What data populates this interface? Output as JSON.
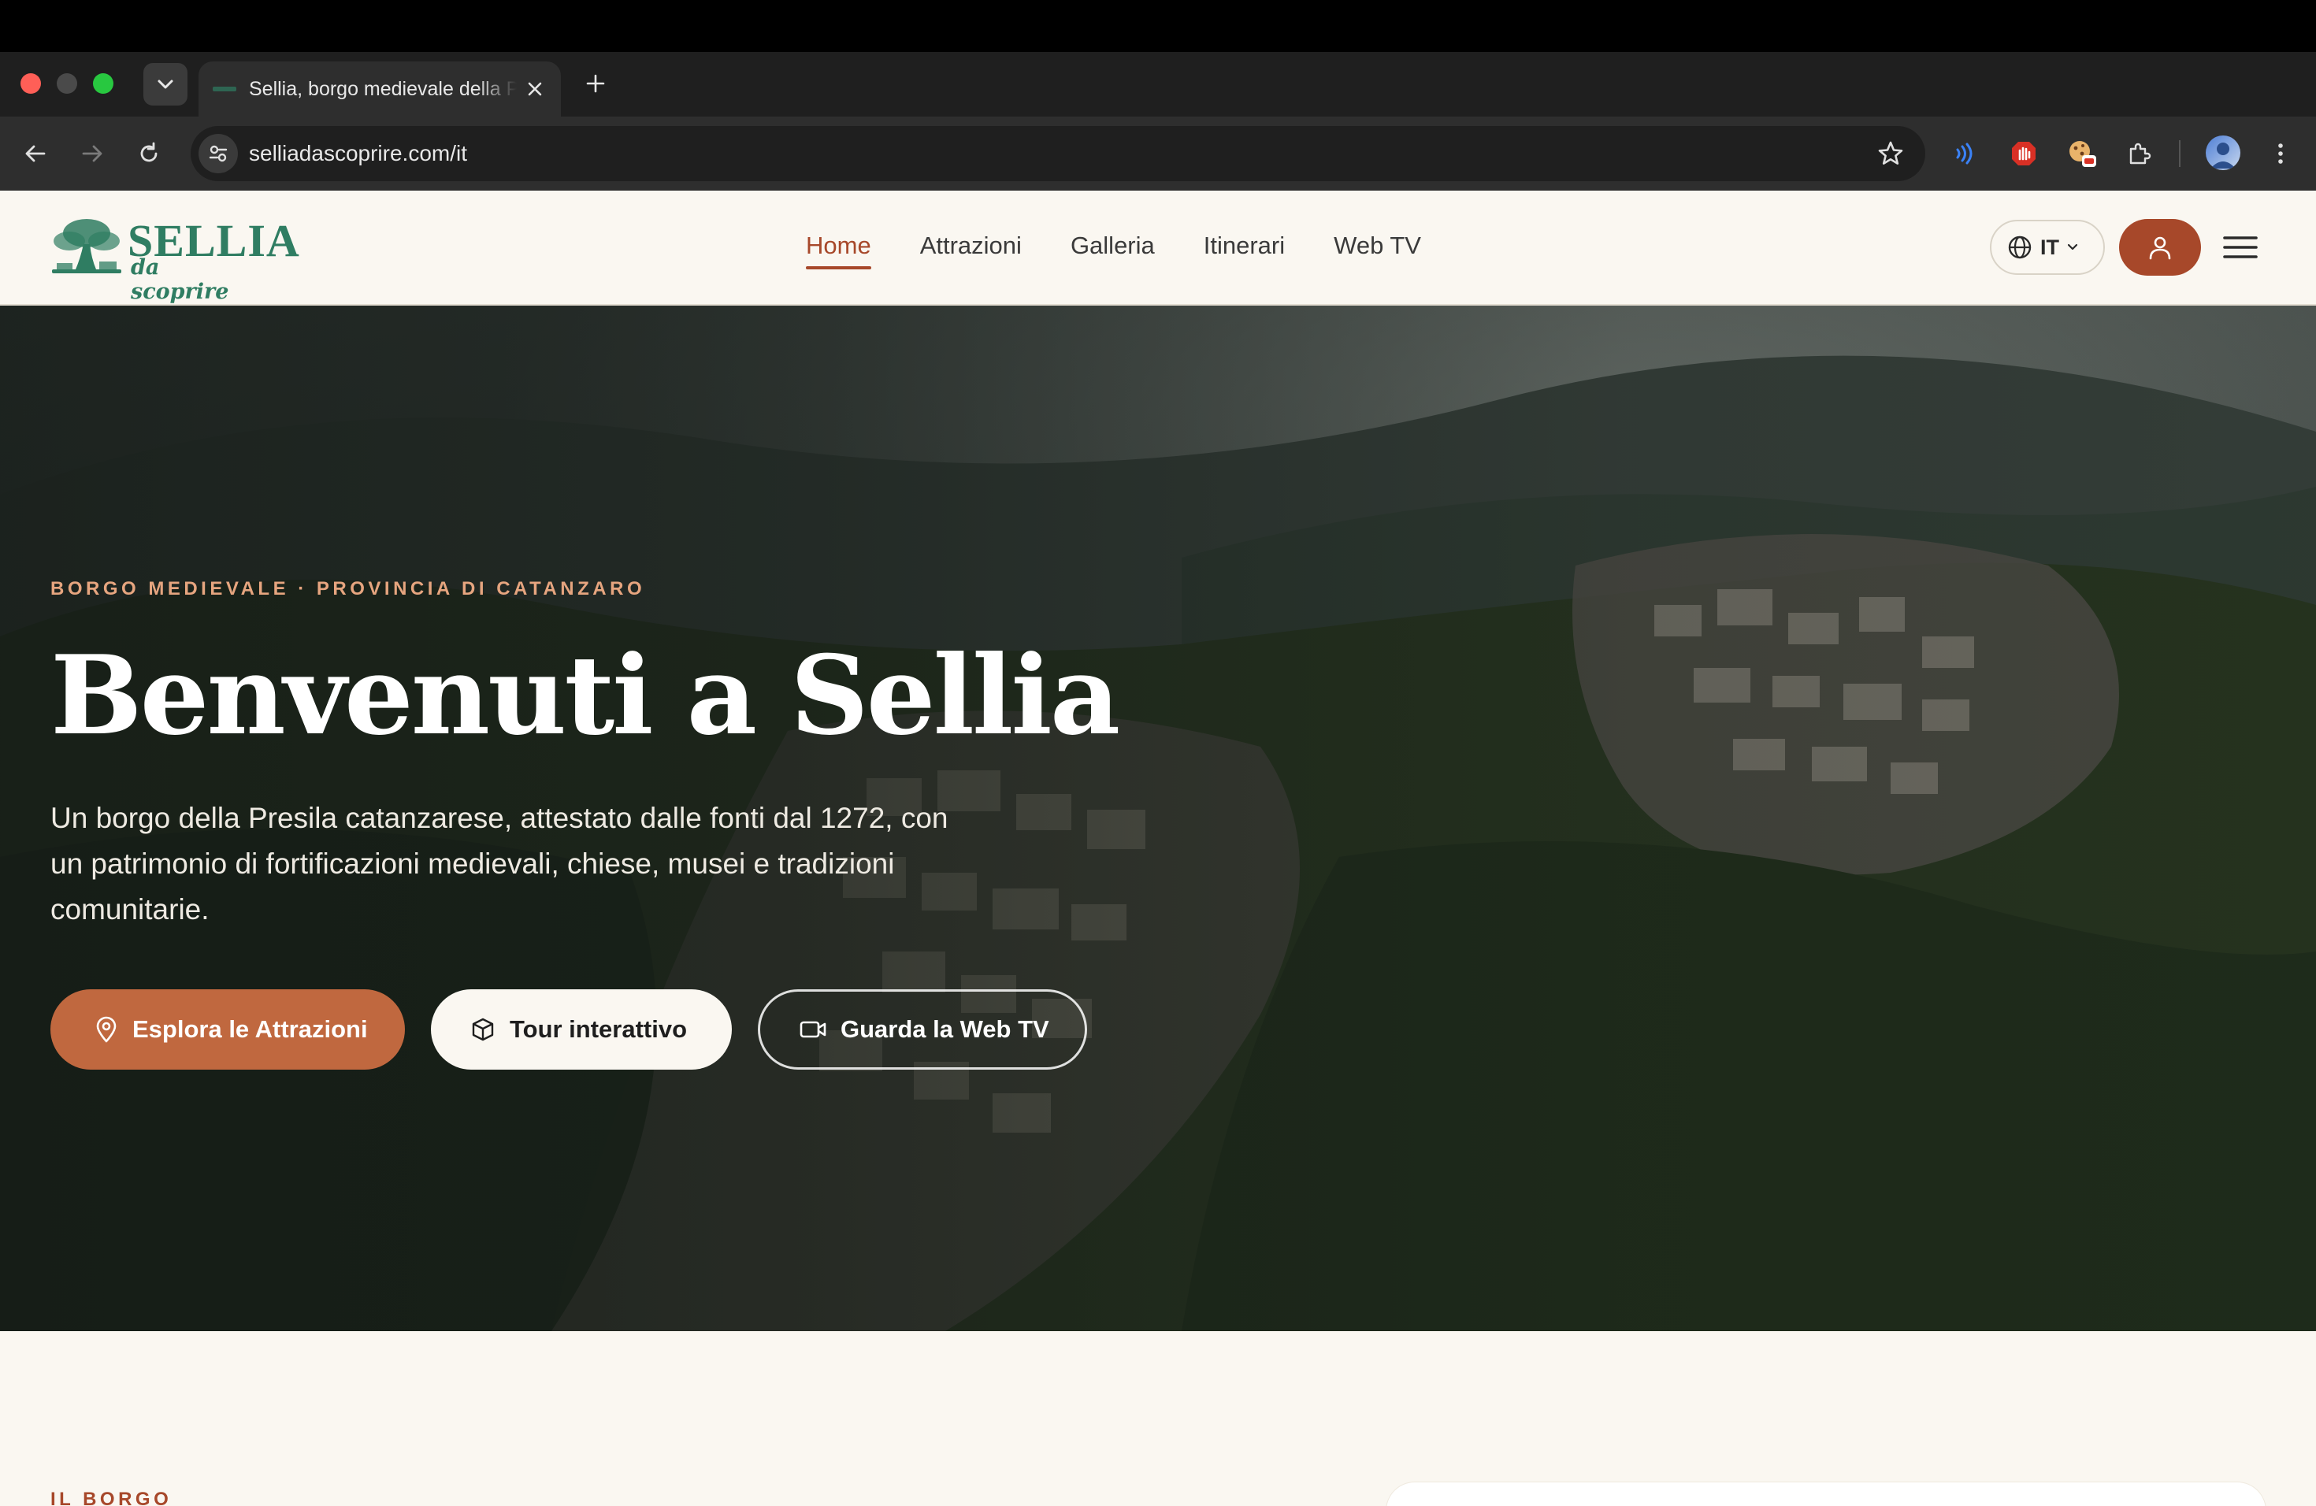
{
  "browser": {
    "tab_title": "Sellia, borgo medievale della Presila",
    "url": "selliadascoprire.com/it"
  },
  "site": {
    "logo": {
      "word": "SELLIA",
      "tagline": "da scoprire"
    },
    "nav": [
      {
        "label": "Home",
        "active": true
      },
      {
        "label": "Attrazioni",
        "active": false
      },
      {
        "label": "Galleria",
        "active": false
      },
      {
        "label": "Itinerari",
        "active": false
      },
      {
        "label": "Web TV",
        "active": false
      }
    ],
    "language": "IT",
    "colors": {
      "accent": "#a7482a",
      "cta": "#c0683f",
      "brand_green": "#2f7d62",
      "cream": "#faf7f1"
    }
  },
  "hero": {
    "eyebrow": "BORGO MEDIEVALE · PROVINCIA DI CATANZARO",
    "title": "Benvenuti a Sellia",
    "lead": "Un borgo della Presila catanzarese, attestato dalle fonti dal 1272, con un patrimonio di fortificazioni medievali, chiese, musei e tradizioni comunitarie.",
    "buttons": {
      "explore": "Esplora le Attrazioni",
      "tour": "Tour interattivo",
      "webtv": "Guarda la Web TV"
    }
  },
  "section": {
    "label": "IL BORGO"
  }
}
